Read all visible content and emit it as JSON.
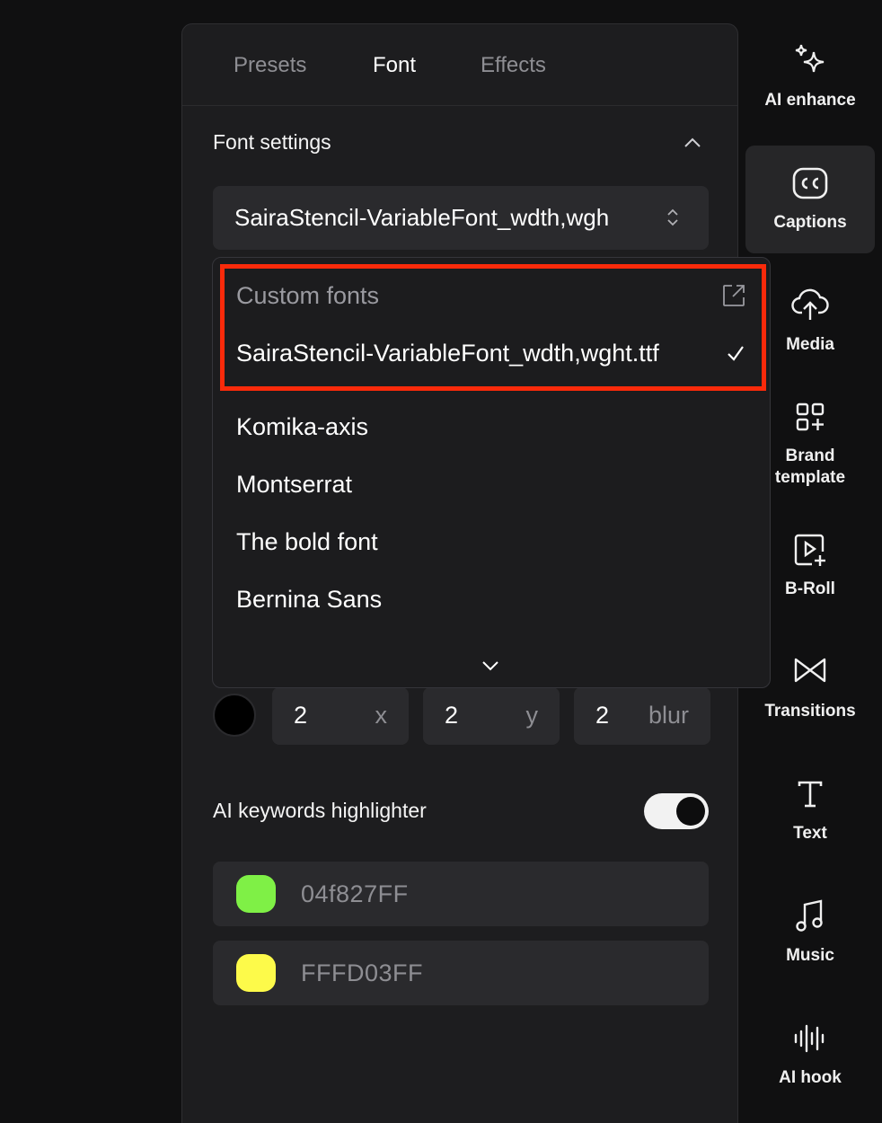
{
  "tabs": [
    {
      "label": "Presets",
      "active": false
    },
    {
      "label": "Font",
      "active": true
    },
    {
      "label": "Effects",
      "active": false
    }
  ],
  "font_settings": {
    "title": "Font settings",
    "selected_font": "SairaStencil-VariableFont_wdth,wgh"
  },
  "dropdown": {
    "custom_header": "Custom fonts",
    "custom_font": "SairaStencil-VariableFont_wdth,wght.ttf",
    "custom_font_selected": true,
    "items": [
      "Komika-axis",
      "Montserrat",
      "The bold font",
      "Bernina Sans"
    ]
  },
  "shadow": {
    "color": "#000000",
    "x": {
      "value": "2",
      "unit": "x"
    },
    "y": {
      "value": "2",
      "unit": "y"
    },
    "blur": {
      "value": "2",
      "unit": "blur"
    }
  },
  "keywords": {
    "label": "AI keywords highlighter",
    "enabled": true,
    "colors": [
      {
        "swatch": "#7ff046",
        "hex": "04f827FF"
      },
      {
        "swatch": "#fdfa4a",
        "hex": "FFFD03FF"
      }
    ]
  },
  "rail": [
    {
      "label": "AI enhance",
      "icon": "sparkle-icon",
      "active": false
    },
    {
      "label": "Captions",
      "icon": "cc-icon",
      "active": true
    },
    {
      "label": "Media",
      "icon": "cloud-upload-icon",
      "active": false
    },
    {
      "label": "Brand\ntemplate",
      "icon": "brand-template-icon",
      "active": false
    },
    {
      "label": "B-Roll",
      "icon": "broll-icon",
      "active": false
    },
    {
      "label": "Transitions",
      "icon": "transitions-icon",
      "active": false
    },
    {
      "label": "Text",
      "icon": "text-icon",
      "active": false
    },
    {
      "label": "Music",
      "icon": "music-icon",
      "active": false
    },
    {
      "label": "AI hook",
      "icon": "waveform-icon",
      "active": false
    }
  ],
  "colors": {
    "highlight_border": "#fa2a0a",
    "panel_bg": "#1d1d1f",
    "field_bg": "#2a2a2d"
  }
}
